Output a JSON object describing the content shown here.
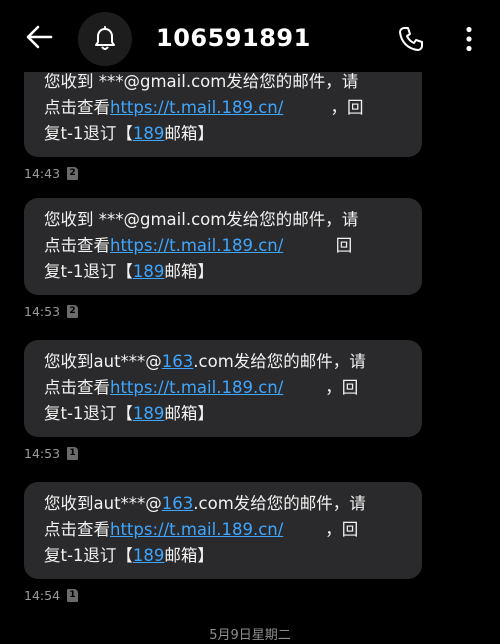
{
  "header": {
    "sender": "106591891",
    "back_icon": "arrow-left-icon",
    "avatar_icon": "bell-icon",
    "call_icon": "phone-icon",
    "more_icon": "more-vertical-icon"
  },
  "messages": [
    {
      "line1": "您收到  ***@gmail.com发给您的邮件，请",
      "line2_pre": "点击查看",
      "link": "https://t.mail.189.cn/",
      "line2_post": "         ，回",
      "line3_pre": "复t-1退订【",
      "line3_link": "189",
      "line3_post": "邮箱】",
      "time": "14:43",
      "sim": "2"
    },
    {
      "line1": "您收到  ***@gmail.com发给您的邮件，请",
      "line2_pre": "点击查看",
      "link": "https://t.mail.189.cn/",
      "line2_post": "          回",
      "line3_pre": "复t-1退订【",
      "line3_link": "189",
      "line3_post": "邮箱】",
      "time": "14:53",
      "sim": "2"
    },
    {
      "line1_pre": "您收到aut***@",
      "line1_link": "163",
      "line1_post": ".com发给您的邮件，请",
      "line2_pre": "点击查看",
      "link": "https://t.mail.189.cn/",
      "line2_post": "        ，回",
      "line3_pre": "复t-1退订【",
      "line3_link": "189",
      "line3_post": "邮箱】",
      "time": "14:53",
      "sim": "1"
    },
    {
      "line1_pre": "您收到aut***@",
      "line1_link": "163",
      "line1_post": ".com发给您的邮件，请",
      "line2_pre": "点击查看",
      "link": "https://t.mail.189.cn/",
      "line2_post": "        ，回",
      "line3_pre": "复t-1退订【",
      "line3_link": "189",
      "line3_post": "邮箱】",
      "time": "14:54",
      "sim": "1"
    }
  ],
  "date_separator": "5月9日星期二",
  "colors": {
    "background": "#000000",
    "bubble": "#2a2a2c",
    "link": "#3ea6ff",
    "meta": "#9a9a9a"
  }
}
